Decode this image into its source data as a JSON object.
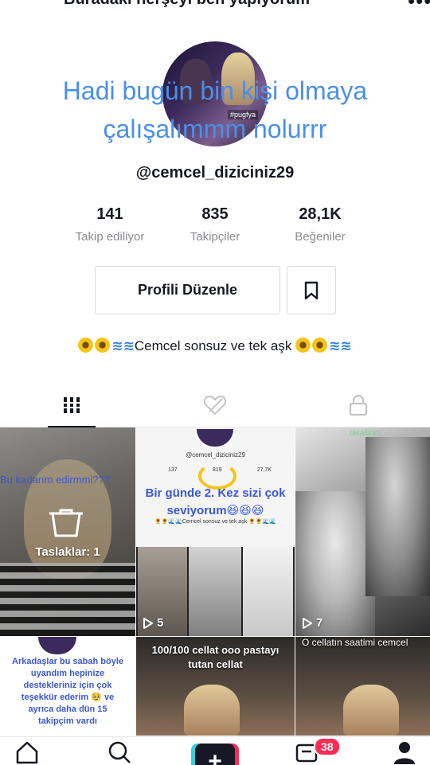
{
  "header": {
    "title": "Buradaki herşeyi ben yapıyorum",
    "add_user_icon": "person-add-icon",
    "more_icon": "more-dots-icon"
  },
  "overlay": {
    "line1": "Hadi bugün bin kişi olmaya",
    "line2": "çalışalımmm nolurrr"
  },
  "profile": {
    "username": "@cemcel_diziciniz29",
    "avatar_tag": "#pugfya",
    "stats": [
      {
        "value": "141",
        "label": "Takip ediliyor"
      },
      {
        "value": "835",
        "label": "Takipçiler"
      },
      {
        "value": "28,1K",
        "label": "Beğeniler"
      }
    ],
    "edit_button": "Profili Düzenle",
    "bio": "Cemcel sonsuz ve tek aşk"
  },
  "tabs": [
    {
      "name": "videos",
      "icon": "grid-icon",
      "active": true
    },
    {
      "name": "liked",
      "icon": "heart-hidden-icon",
      "active": false
    },
    {
      "name": "private",
      "icon": "lock-icon",
      "active": false
    }
  ],
  "grid": {
    "drafts": {
      "overlay_text": "Bu kadarım edirmmi???",
      "label": "Taslaklar: 1"
    },
    "cell2": {
      "mini_user": "@cemcel_diziciniz29",
      "mini_stats": [
        "137",
        "819",
        "27,7K"
      ],
      "text": "Bir günde 2. Kez sizi  çok seviyorum😆😆😆",
      "mini_bio": "🌻🌻🌊🌊Cemcel sonsuz ve tek aşk 🌻🌻🌊🌊",
      "plays": "5"
    },
    "cell3": {
      "top_text": "olsaliirim",
      "plays": "7"
    },
    "cell4": {
      "text": "Arkadaşlar bu sabah böyle\nuyandım hepinize\ndestekleriniz için çok\nteşekkür ederim 🥹 ve\nayrıca daha dün 15\ntakipçim vardı"
    },
    "cell5": {
      "text": "100/100 cellat ooo pastayı\ntutan cellat"
    },
    "cell6": {
      "text": "O cellatın saatimi cemcel"
    }
  },
  "bottom_nav": {
    "items": [
      "home-icon",
      "search-icon",
      "create-icon",
      "inbox-icon",
      "profile-icon"
    ],
    "inbox_badge": "38"
  },
  "colors": {
    "overlay_blue": "#4a8fe8",
    "accent_red": "#fe2c55",
    "accent_cyan": "#2fd4e0",
    "text_dark": "#161823",
    "text_gray": "#8a8b91"
  }
}
